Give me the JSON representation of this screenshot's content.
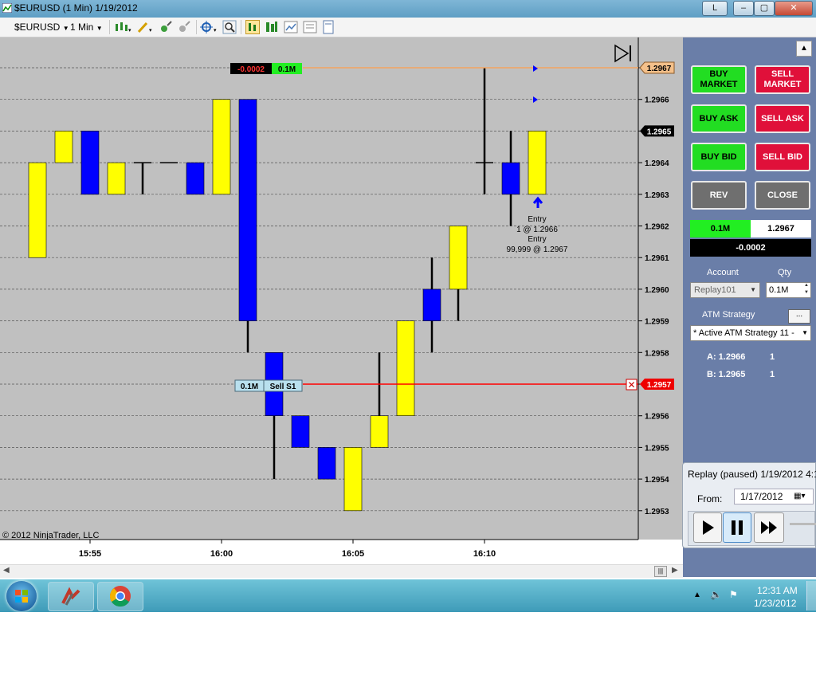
{
  "window": {
    "title": "$EURUSD (1 Min)  1/19/2012",
    "buttons": {
      "layout": "L",
      "minimize": "–",
      "restore": "▢",
      "close": "✕"
    }
  },
  "toolbar": {
    "instrument": "$EURUSD",
    "interval": "1 Min"
  },
  "chart": {
    "copyright": "© 2012 NinjaTrader, LLC",
    "price_labels": [
      "1.2966",
      "1.2965",
      "1.2964",
      "1.2963",
      "1.2962",
      "1.2961",
      "1.2960",
      "1.2959",
      "1.2958",
      "1.2956",
      "1.2955",
      "1.2954",
      "1.2953"
    ],
    "time_labels": [
      "15:55",
      "16:00",
      "16:05",
      "16:10"
    ],
    "ask_marker": "1.2967",
    "last_marker": "1.2965",
    "order_marker": "1.2957",
    "pnl_tag": "-0.0002",
    "pnl_qty": "0.1M",
    "order_qty": "0.1M",
    "order_name": "Sell S1",
    "order_close": "✕",
    "entry_label_1": "Entry",
    "entry_fill_1": "1 @ 1.2966",
    "entry_label_2": "Entry",
    "entry_fill_2": "99,999 @ 1.2967",
    "colors": {
      "up": "#ffff00",
      "down": "#0000ff",
      "order_line": "#ff0000",
      "ask_line": "#f4a460",
      "background": "#c0c0c0"
    }
  },
  "chart_data": {
    "type": "candlestick",
    "ylim": [
      1.29525,
      1.29675
    ],
    "x_ticks": [
      "15:55",
      "16:00",
      "16:05",
      "16:10"
    ],
    "bars": [
      {
        "o": 1.2961,
        "h": 1.2964,
        "l": 1.2961,
        "c": 1.2964
      },
      {
        "o": 1.2964,
        "h": 1.2965,
        "l": 1.2964,
        "c": 1.2965
      },
      {
        "o": 1.2965,
        "h": 1.2965,
        "l": 1.2963,
        "c": 1.2963
      },
      {
        "o": 1.2963,
        "h": 1.2964,
        "l": 1.2963,
        "c": 1.2964
      },
      {
        "o": 1.2964,
        "h": 1.2964,
        "l": 1.2963,
        "c": 1.2964
      },
      {
        "o": 1.2964,
        "h": 1.2964,
        "l": 1.2964,
        "c": 1.2964
      },
      {
        "o": 1.2964,
        "h": 1.2964,
        "l": 1.2963,
        "c": 1.2963
      },
      {
        "o": 1.2963,
        "h": 1.2966,
        "l": 1.2963,
        "c": 1.2966
      },
      {
        "o": 1.2966,
        "h": 1.2966,
        "l": 1.2958,
        "c": 1.2959
      },
      {
        "o": 1.2958,
        "h": 1.2958,
        "l": 1.2954,
        "c": 1.2956
      },
      {
        "o": 1.2956,
        "h": 1.2956,
        "l": 1.2955,
        "c": 1.2955
      },
      {
        "o": 1.2955,
        "h": 1.2955,
        "l": 1.2954,
        "c": 1.2954
      },
      {
        "o": 1.2953,
        "h": 1.2955,
        "l": 1.2953,
        "c": 1.2955
      },
      {
        "o": 1.2955,
        "h": 1.2958,
        "l": 1.2955,
        "c": 1.2956
      },
      {
        "o": 1.2956,
        "h": 1.2959,
        "l": 1.2956,
        "c": 1.2959
      },
      {
        "o": 1.296,
        "h": 1.2961,
        "l": 1.2958,
        "c": 1.2959
      },
      {
        "o": 1.296,
        "h": 1.2962,
        "l": 1.2959,
        "c": 1.2962
      },
      {
        "o": 1.2964,
        "h": 1.2967,
        "l": 1.2963,
        "c": 1.2964
      },
      {
        "o": 1.2964,
        "h": 1.2965,
        "l": 1.2962,
        "c": 1.2963
      },
      {
        "o": 1.2963,
        "h": 1.2965,
        "l": 1.2963,
        "c": 1.2965
      }
    ]
  },
  "panel": {
    "buy_market": [
      "BUY",
      "MARKET"
    ],
    "sell_market": [
      "SELL",
      "MARKET"
    ],
    "buy_ask": "BUY ASK",
    "sell_ask": "SELL ASK",
    "buy_bid": "BUY BID",
    "sell_bid": "SELL BID",
    "rev": "REV",
    "close": "CLOSE",
    "position_qty": "0.1M",
    "position_price": "1.2967",
    "position_pnl": "-0.0002",
    "account_label": "Account",
    "qty_label": "Qty",
    "account_value": "Replay101",
    "qty_value": "0.1M",
    "atm_label": "ATM Strategy",
    "atm_more": "...",
    "atm_value": "* Active ATM Strategy 11 -",
    "a_label": "A: 1.2966",
    "a_qty": "1",
    "b_label": "B: 1.2965",
    "b_qty": "1"
  },
  "replay": {
    "title": "Replay (paused) 1/19/2012 4:1",
    "from_label": "From:",
    "from_value": "1/17/2012"
  },
  "taskbar": {
    "time": "12:31 AM",
    "date": "1/23/2012"
  }
}
